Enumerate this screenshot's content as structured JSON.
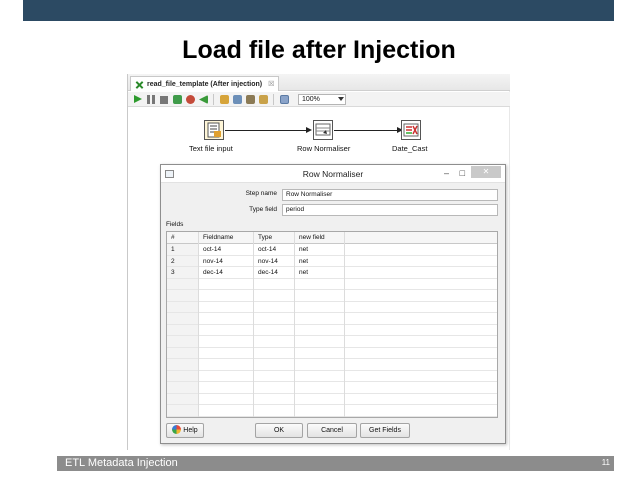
{
  "slide": {
    "title": "Load file after Injection",
    "footer_text": "ETL Metadata Injection",
    "page_number": "11"
  },
  "editor": {
    "tab_label": "read_file_template (After injection)",
    "tab_close": "☒",
    "zoom": "100%",
    "toolbar_icons": [
      "run-icon",
      "pause-icon",
      "stop-icon",
      "preview-icon",
      "debug-icon",
      "replay-icon",
      "verify-icon",
      "impact-icon",
      "sql-icon",
      "explore-db-icon",
      "show-results-icon"
    ]
  },
  "canvas": {
    "steps": [
      {
        "name": "Text file input",
        "icon": "text-file-input-icon"
      },
      {
        "name": "Row Normaliser",
        "icon": "row-normaliser-icon"
      },
      {
        "name": "Date_Cast",
        "icon": "select-values-icon"
      }
    ]
  },
  "dialog": {
    "title": "Row Normaliser",
    "minimize": "–",
    "maximize": "□",
    "close": "✕",
    "step_name_label": "Step name",
    "step_name_value": "Row Normaliser",
    "type_field_label": "Type field",
    "type_field_value": "period",
    "fields_label": "Fields",
    "columns": [
      "#",
      "Fieldname",
      "Type",
      "new field"
    ],
    "rows": [
      [
        "1",
        "oct-14",
        "oct-14",
        "net"
      ],
      [
        "2",
        "nov-14",
        "nov-14",
        "net"
      ],
      [
        "3",
        "dec-14",
        "dec-14",
        "net"
      ]
    ],
    "buttons": {
      "help": "Help",
      "ok": "OK",
      "cancel": "Cancel",
      "get_fields": "Get Fields"
    }
  },
  "colors": {
    "topbar": "#2c4a63",
    "footer": "#8c8c8c"
  }
}
